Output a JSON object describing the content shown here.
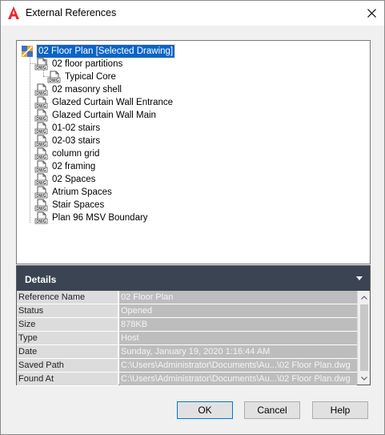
{
  "window": {
    "title": "External References",
    "app_icon": "autocad-a-icon",
    "accent_color": "#e8262e"
  },
  "tree": {
    "nodes": [
      {
        "name": "root-node",
        "label": "02 Floor Plan [Selected Drawing]",
        "icon": "drawing-root-icon",
        "selected": true
      },
      {
        "name": "xref-02-floor-partitions",
        "label": "02 floor partitions",
        "icon": "dwg-file-icon"
      },
      {
        "name": "xref-typical-core",
        "label": "Typical Core",
        "icon": "dwg-file-icon"
      },
      {
        "name": "xref-02-masonry-shell",
        "label": "02 masonry shell",
        "icon": "dwg-file-icon"
      },
      {
        "name": "xref-glazed-curtain-wall-entrance",
        "label": "Glazed Curtain Wall Entrance",
        "icon": "dwg-file-icon"
      },
      {
        "name": "xref-glazed-curtain-wall-main",
        "label": "Glazed Curtain Wall Main",
        "icon": "dwg-file-icon"
      },
      {
        "name": "xref-01-02-stairs",
        "label": "01-02 stairs",
        "icon": "dwg-file-icon"
      },
      {
        "name": "xref-02-03-stairs",
        "label": "02-03 stairs",
        "icon": "dwg-file-icon"
      },
      {
        "name": "xref-column-grid",
        "label": "column grid",
        "icon": "dwg-file-icon"
      },
      {
        "name": "xref-02-framing",
        "label": "02 framing",
        "icon": "dwg-file-icon"
      },
      {
        "name": "xref-02-spaces",
        "label": "02 Spaces",
        "icon": "dwg-file-icon"
      },
      {
        "name": "xref-atrium-spaces",
        "label": "Atrium Spaces",
        "icon": "dwg-file-icon"
      },
      {
        "name": "xref-stair-spaces",
        "label": "Stair Spaces",
        "icon": "dwg-file-icon"
      },
      {
        "name": "xref-plan-96-msv-boundary",
        "label": "Plan 96 MSV Boundary",
        "icon": "dwg-file-icon"
      }
    ],
    "dwg_badge": "DWG"
  },
  "details": {
    "title": "Details",
    "rows": [
      {
        "name": "Reference Name",
        "value": "02 Floor Plan"
      },
      {
        "name": "Status",
        "value": "Opened"
      },
      {
        "name": "Size",
        "value": "878KB"
      },
      {
        "name": "Type",
        "value": "Host"
      },
      {
        "name": "Date",
        "value": "Sunday, January 19, 2020  1:16:44 AM"
      },
      {
        "name": "Saved Path",
        "value": "C:\\Users\\Administrator\\Documents\\Au...\\02 Floor Plan.dwg"
      },
      {
        "name": "Found At",
        "value": "C:\\Users\\Administrator\\Documents\\Au...\\02 Floor Plan.dwg"
      }
    ]
  },
  "buttons": {
    "ok": "OK",
    "cancel": "Cancel",
    "help": "Help"
  }
}
